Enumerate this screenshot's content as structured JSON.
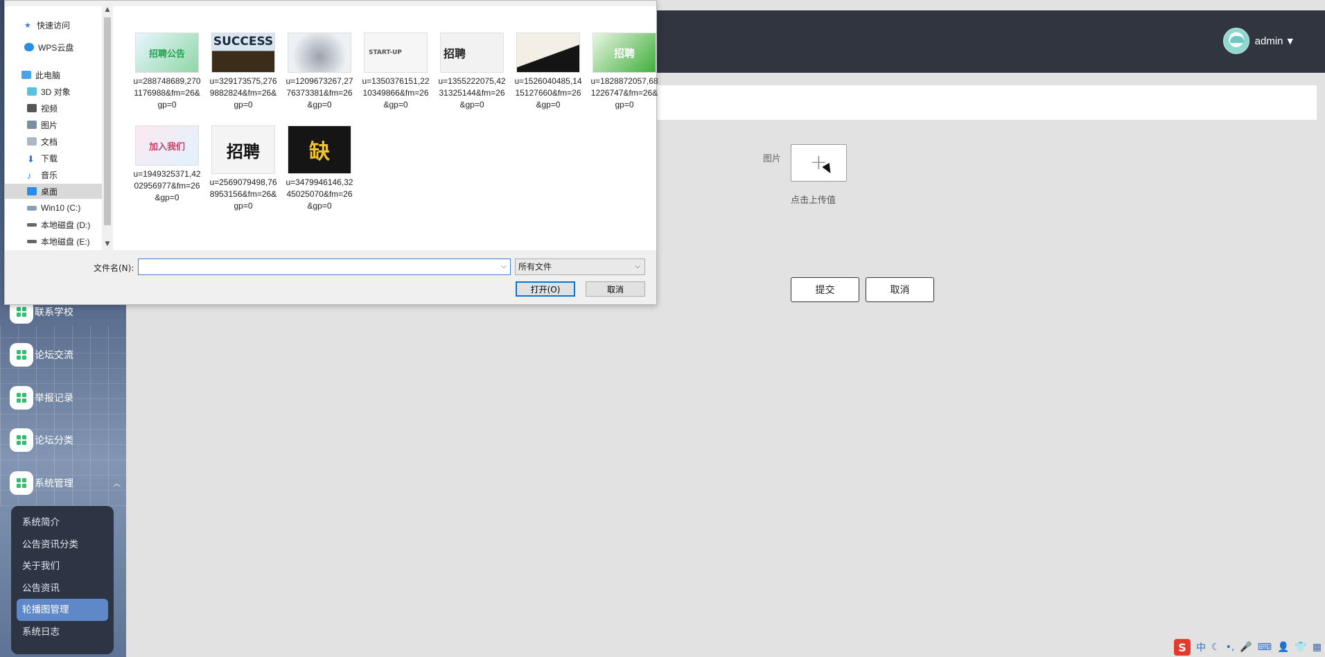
{
  "header": {
    "title": "",
    "username": "admin"
  },
  "sidebar": {
    "items": [
      {
        "label": "联系学校"
      },
      {
        "label": "论坛交流"
      },
      {
        "label": "举报记录"
      },
      {
        "label": "论坛分类"
      },
      {
        "label": "系统管理"
      }
    ],
    "submenu": [
      {
        "label": "系统简介"
      },
      {
        "label": "公告资讯分类"
      },
      {
        "label": "关于我们"
      },
      {
        "label": "公告资讯"
      },
      {
        "label": "轮播图管理",
        "active": true
      },
      {
        "label": "系统日志"
      }
    ]
  },
  "form": {
    "image_label": "图片",
    "upload_hint": "点击上传值",
    "submit_label": "提交",
    "cancel_label": "取消"
  },
  "dialog": {
    "nav": [
      {
        "label": "快速访问",
        "icon": "star-icon"
      },
      {
        "label": "WPS云盘",
        "icon": "cloud-icon"
      },
      {
        "label": "此电脑",
        "icon": "computer-icon"
      },
      {
        "label": "3D 对象",
        "icon": "cube-icon"
      },
      {
        "label": "视频",
        "icon": "video-icon"
      },
      {
        "label": "图片",
        "icon": "picture-icon"
      },
      {
        "label": "文档",
        "icon": "document-icon"
      },
      {
        "label": "下载",
        "icon": "download-icon"
      },
      {
        "label": "音乐",
        "icon": "music-icon"
      },
      {
        "label": "桌面",
        "icon": "desktop-icon",
        "selected": true
      },
      {
        "label": "Win10 (C:)",
        "icon": "drive-icon"
      },
      {
        "label": "本地磁盘 (D:)",
        "icon": "drive-icon"
      },
      {
        "label": "本地磁盘 (E:)",
        "icon": "drive-icon"
      }
    ],
    "files": [
      {
        "name": "u=288748689,2701176988&fm=26&gp=0",
        "thumb_text": "招聘公告"
      },
      {
        "name": "u=329173575,2769882824&fm=26&gp=0",
        "thumb_text": "SUCCESS"
      },
      {
        "name": "u=1209673267,2776373381&fm=26&gp=0",
        "thumb_text": ""
      },
      {
        "name": "u=1350376151,2210349866&fm=26&gp=0",
        "thumb_text": "START-UP"
      },
      {
        "name": "u=1355222075,4231325144&fm=26&gp=0",
        "thumb_text": "招聘"
      },
      {
        "name": "u=1526040485,1415127660&fm=26&gp=0",
        "thumb_text": ""
      },
      {
        "name": "u=1828872057,681226747&fm=26&gp=0",
        "thumb_text": "招聘"
      },
      {
        "name": "u=1949325371,4202956977&fm=26&gp=0",
        "thumb_text": "加入我们"
      },
      {
        "name": "u=2569079498,768953156&fm=26&gp=0",
        "thumb_text": "招聘"
      },
      {
        "name": "u=3479946146,3245025070&fm=26&gp=0",
        "thumb_text": "缺"
      }
    ],
    "filename_label": "文件名(N):",
    "filename_value": "",
    "filetype_value": "所有文件",
    "open_label": "打开(O)",
    "cancel_label": "取消"
  },
  "tray": {
    "ime_label": "S",
    "ime_mode": "中"
  }
}
